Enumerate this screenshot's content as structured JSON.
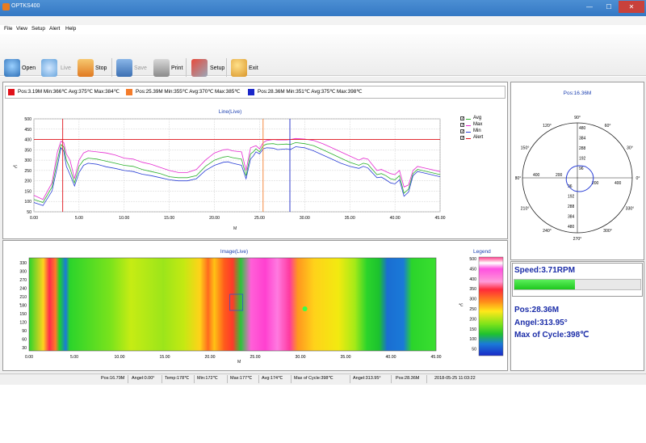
{
  "window": {
    "title": "OPTKS400",
    "controls": [
      "—",
      "☐",
      "✕"
    ]
  },
  "menu": [
    "File",
    "View",
    "Setup",
    "Alert",
    "Help"
  ],
  "toolbar": [
    {
      "label": "Open",
      "icon": "magnifier-icon",
      "enabled": true
    },
    {
      "label": "Live",
      "icon": "gears-icon",
      "enabled": false
    },
    {
      "label": "Stop",
      "icon": "stop-icon",
      "enabled": true
    },
    {
      "label": "Save",
      "icon": "floppy-icon",
      "enabled": false
    },
    {
      "label": "Print",
      "icon": "printer-icon",
      "enabled": true
    },
    {
      "label": "Setup",
      "icon": "tools-icon",
      "enabled": true
    },
    {
      "label": "Exit",
      "icon": "key-icon",
      "enabled": true
    }
  ],
  "cursor_legend": [
    {
      "color": "#e0121a",
      "text": "Pos:3.19M Min:366℃ Avg:375℃ Max:384℃"
    },
    {
      "color": "#f47c2b",
      "text": "Pos:25.39M Min:355℃ Avg:370℃ Max:385℃"
    },
    {
      "color": "#1b27c9",
      "text": "Pos:28.36M Min:351℃ Avg:375℃ Max:398℃"
    }
  ],
  "line_chart": {
    "title": "Line(Live)",
    "ylabel": "℃",
    "xlabel": "M",
    "yticks": [
      "500",
      "450",
      "400",
      "350",
      "300",
      "250",
      "200",
      "150",
      "100",
      "50"
    ],
    "xticks": [
      "0.00",
      "5.00",
      "10.00",
      "15.00",
      "20.00",
      "25.00",
      "30.00",
      "35.00",
      "40.00",
      "45.00"
    ],
    "series_legend": [
      {
        "name": "Avg",
        "color": "#2bb02b"
      },
      {
        "name": "Max",
        "color": "#e52ad0"
      },
      {
        "name": "Min",
        "color": "#2a3fd6"
      },
      {
        "name": "Alert",
        "color": "#e0121a"
      }
    ]
  },
  "chart_data": {
    "type": "line",
    "title": "Line(Live)",
    "xlabel": "M",
    "ylabel": "℃",
    "xlim": [
      0,
      45
    ],
    "ylim": [
      50,
      500
    ],
    "grid": true,
    "legend": "right",
    "x": [
      0,
      1,
      2,
      2.6,
      3.0,
      3.3,
      3.6,
      4.0,
      4.5,
      5.0,
      5.5,
      6,
      7,
      8,
      9,
      10,
      11,
      12,
      13,
      14,
      15,
      16,
      17,
      18,
      19,
      20,
      21,
      21.5,
      22,
      23,
      23.5,
      24,
      24.3,
      24.6,
      25,
      25.4,
      25.8,
      26.5,
      27,
      28,
      28.4,
      29,
      30,
      31,
      32,
      33,
      34,
      35,
      36,
      36.5,
      37,
      38,
      38.5,
      39,
      39.5,
      40,
      40.5,
      41,
      41.5,
      42,
      42.5,
      43,
      44,
      45
    ],
    "series": [
      {
        "name": "Max",
        "values": [
          130,
          110,
          190,
          340,
          392,
          385,
          330,
          300,
          210,
          300,
          335,
          345,
          340,
          335,
          325,
          310,
          305,
          290,
          280,
          265,
          250,
          240,
          240,
          255,
          300,
          335,
          350,
          352,
          345,
          340,
          250,
          360,
          365,
          370,
          355,
          385,
          395,
          400,
          398,
          398,
          400,
          405,
          402,
          395,
          380,
          360,
          340,
          320,
          300,
          310,
          305,
          250,
          255,
          245,
          235,
          230,
          250,
          170,
          180,
          250,
          270,
          265,
          255,
          245
        ]
      },
      {
        "name": "Avg",
        "values": [
          110,
          95,
          170,
          300,
          375,
          365,
          300,
          260,
          190,
          270,
          300,
          310,
          305,
          295,
          285,
          275,
          270,
          255,
          245,
          235,
          220,
          215,
          215,
          225,
          270,
          300,
          315,
          318,
          312,
          305,
          225,
          330,
          340,
          355,
          340,
          370,
          378,
          380,
          375,
          378,
          375,
          385,
          380,
          370,
          350,
          330,
          310,
          290,
          275,
          285,
          280,
          230,
          235,
          225,
          210,
          205,
          225,
          140,
          160,
          235,
          255,
          250,
          240,
          230
        ]
      },
      {
        "name": "Min",
        "values": [
          95,
          80,
          150,
          270,
          360,
          345,
          270,
          230,
          175,
          240,
          275,
          285,
          280,
          268,
          260,
          250,
          245,
          232,
          225,
          215,
          205,
          200,
          200,
          210,
          250,
          275,
          290,
          292,
          285,
          275,
          210,
          305,
          320,
          340,
          330,
          355,
          360,
          358,
          351,
          355,
          351,
          365,
          360,
          345,
          325,
          305,
          285,
          270,
          260,
          270,
          262,
          215,
          218,
          205,
          190,
          185,
          205,
          125,
          145,
          225,
          245,
          240,
          230,
          220
        ]
      },
      {
        "name": "Alert",
        "values": [
          400,
          400
        ]
      }
    ],
    "cursors": [
      {
        "x": 3.19,
        "color": "#e0121a"
      },
      {
        "x": 25.39,
        "color": "#f47c2b"
      },
      {
        "x": 28.36,
        "color": "#1b27c9"
      }
    ]
  },
  "image_panel": {
    "title": "Image(Live)",
    "ylabel": "°",
    "xlabel": "M",
    "yticks": [
      "330",
      "300",
      "270",
      "240",
      "210",
      "180",
      "150",
      "120",
      "90",
      "60",
      "30"
    ],
    "xticks": [
      "0.00",
      "5.00",
      "10.00",
      "15.00",
      "20.00",
      "25.00",
      "30.00",
      "35.00",
      "40.00",
      "45.00"
    ],
    "legend_title": "Legend",
    "legend_ticks": [
      "500",
      "450",
      "400",
      "350",
      "300",
      "250",
      "200",
      "150",
      "100",
      "50"
    ],
    "legend_unit": "℃"
  },
  "polar": {
    "title": "Pos:16.36M",
    "angle_labels": [
      "90°",
      "60°",
      "30°",
      "0°",
      "330°",
      "300°",
      "270°",
      "240°",
      "210°",
      "180°",
      "150°",
      "120°"
    ],
    "radius_labels_up": [
      "480",
      "384",
      "288",
      "192",
      "96"
    ],
    "radius_labels_down": [
      "96",
      "192",
      "288",
      "384",
      "480"
    ],
    "radius_labels_left": [
      "400",
      "200"
    ],
    "radius_labels_right": [
      "200",
      "400"
    ]
  },
  "speed": {
    "label": "Speed:3.71RPM",
    "progress": 0.48
  },
  "readout": {
    "pos": "Pos:28.36M",
    "angle": "Angel:313.95°",
    "max_cycle": "Max of Cycle:398℃"
  },
  "status": [
    "Pos:16.79M",
    "Angel:0.00°",
    "Temp:178℃",
    "Min:172℃",
    "Max:177℃",
    "Avg:174℃",
    "Max of Cycle:398℃",
    "Angel:313.95°",
    "Pos:28.36M",
    "2018-05-25 11:03:22"
  ]
}
